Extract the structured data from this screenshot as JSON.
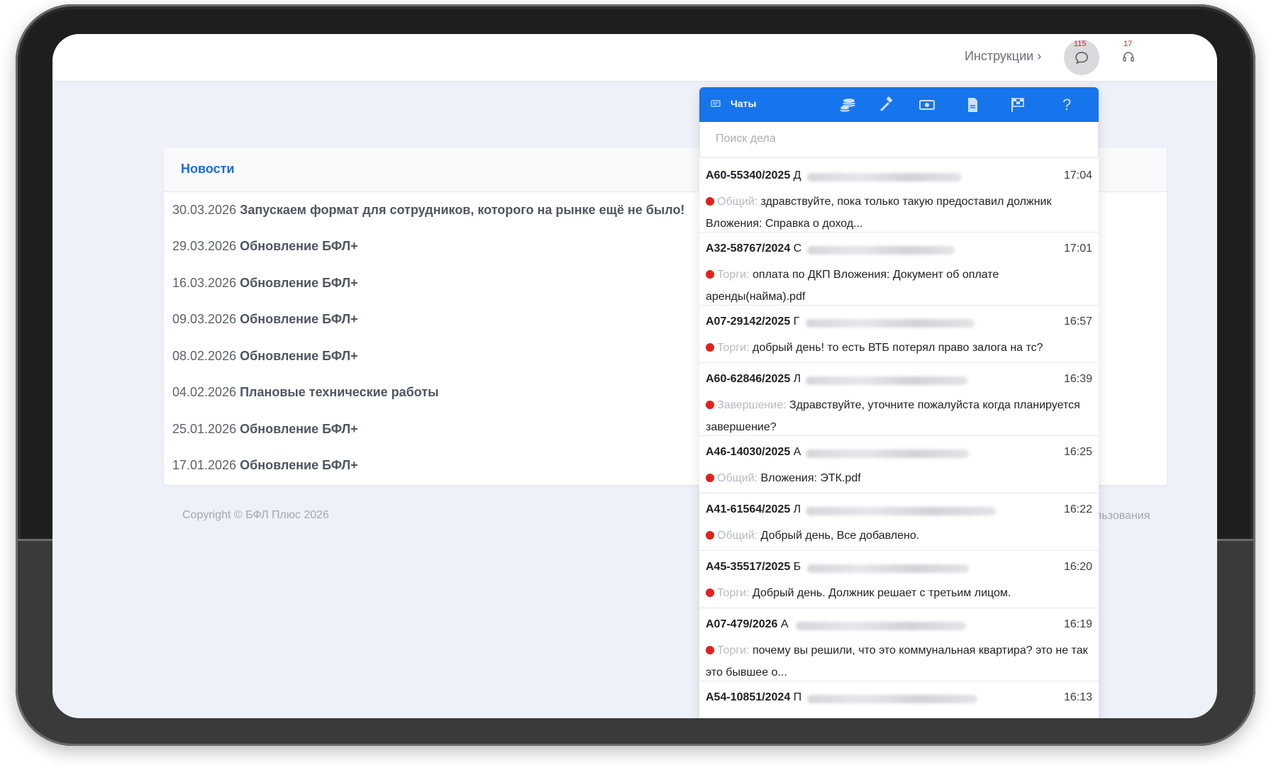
{
  "topbar": {
    "instructions_label": "Инструкции",
    "chat_badge": "115",
    "support_badge": "17"
  },
  "news": {
    "title": "Новости",
    "items": [
      {
        "date": "30.03.2026",
        "title": "Запускаем формат для сотрудников, которого на рынке ещё не было!"
      },
      {
        "date": "29.03.2026",
        "title": "Обновление БФЛ+"
      },
      {
        "date": "16.03.2026",
        "title": "Обновление БФЛ+"
      },
      {
        "date": "09.03.2026",
        "title": "Обновление БФЛ+"
      },
      {
        "date": "08.02.2026",
        "title": "Обновление БФЛ+"
      },
      {
        "date": "04.02.2026",
        "title": "Плановые технические работы"
      },
      {
        "date": "25.01.2026",
        "title": "Обновление БФЛ+"
      },
      {
        "date": "17.01.2026",
        "title": "Обновление БФЛ+"
      }
    ]
  },
  "footer": {
    "copyright": "Copyright © БФЛ Плюс 2026",
    "terms_fragment": "льзования"
  },
  "chat": {
    "title": "Чаты",
    "search_placeholder": "Поиск дела",
    "items": [
      {
        "case": "А60-55340/2025",
        "initial": "Д",
        "time": "17:04",
        "category": "Общий:",
        "text": "здравствуйте, пока только такую предоставил должник Вложения: Справка о доход..."
      },
      {
        "case": "А32-58767/2024",
        "initial": "С",
        "time": "17:01",
        "category": "Торги:",
        "text": "оплата по ДКП Вложения: Документ об оплате аренды(найма).pdf"
      },
      {
        "case": "А07-29142/2025",
        "initial": "Г",
        "time": "16:57",
        "category": "Торги:",
        "text": "добрый день! то есть ВТБ потерял право залога на тс?"
      },
      {
        "case": "А60-62846/2025",
        "initial": "Л",
        "time": "16:39",
        "category": "Завершение:",
        "text": "Здравствуйте, уточните пожалуйста когда планируется завершение?"
      },
      {
        "case": "А46-14030/2025",
        "initial": "А",
        "time": "16:25",
        "category": "Общий:",
        "text": " Вложения: ЭТК.pdf"
      },
      {
        "case": "А41-61564/2025",
        "initial": "Л",
        "time": "16:22",
        "category": "Общий:",
        "text": "Добрый день, Все добавлено."
      },
      {
        "case": "А45-35517/2025",
        "initial": "Б",
        "time": "16:20",
        "category": "Торги:",
        "text": "Добрый день. Должник решает с третьим лицом."
      },
      {
        "case": "А07-479/2026",
        "initial": "А",
        "time": "16:19",
        "category": "Торги:",
        "text": "почему вы решили, что это коммунальная квартира? это не так это бывшее о..."
      },
      {
        "case": "А54-10851/2024",
        "initial": "П",
        "time": "16:13",
        "category": "",
        "text": ""
      }
    ]
  },
  "colors": {
    "accent": "#1675ec",
    "status_dot": "#e5201c"
  }
}
